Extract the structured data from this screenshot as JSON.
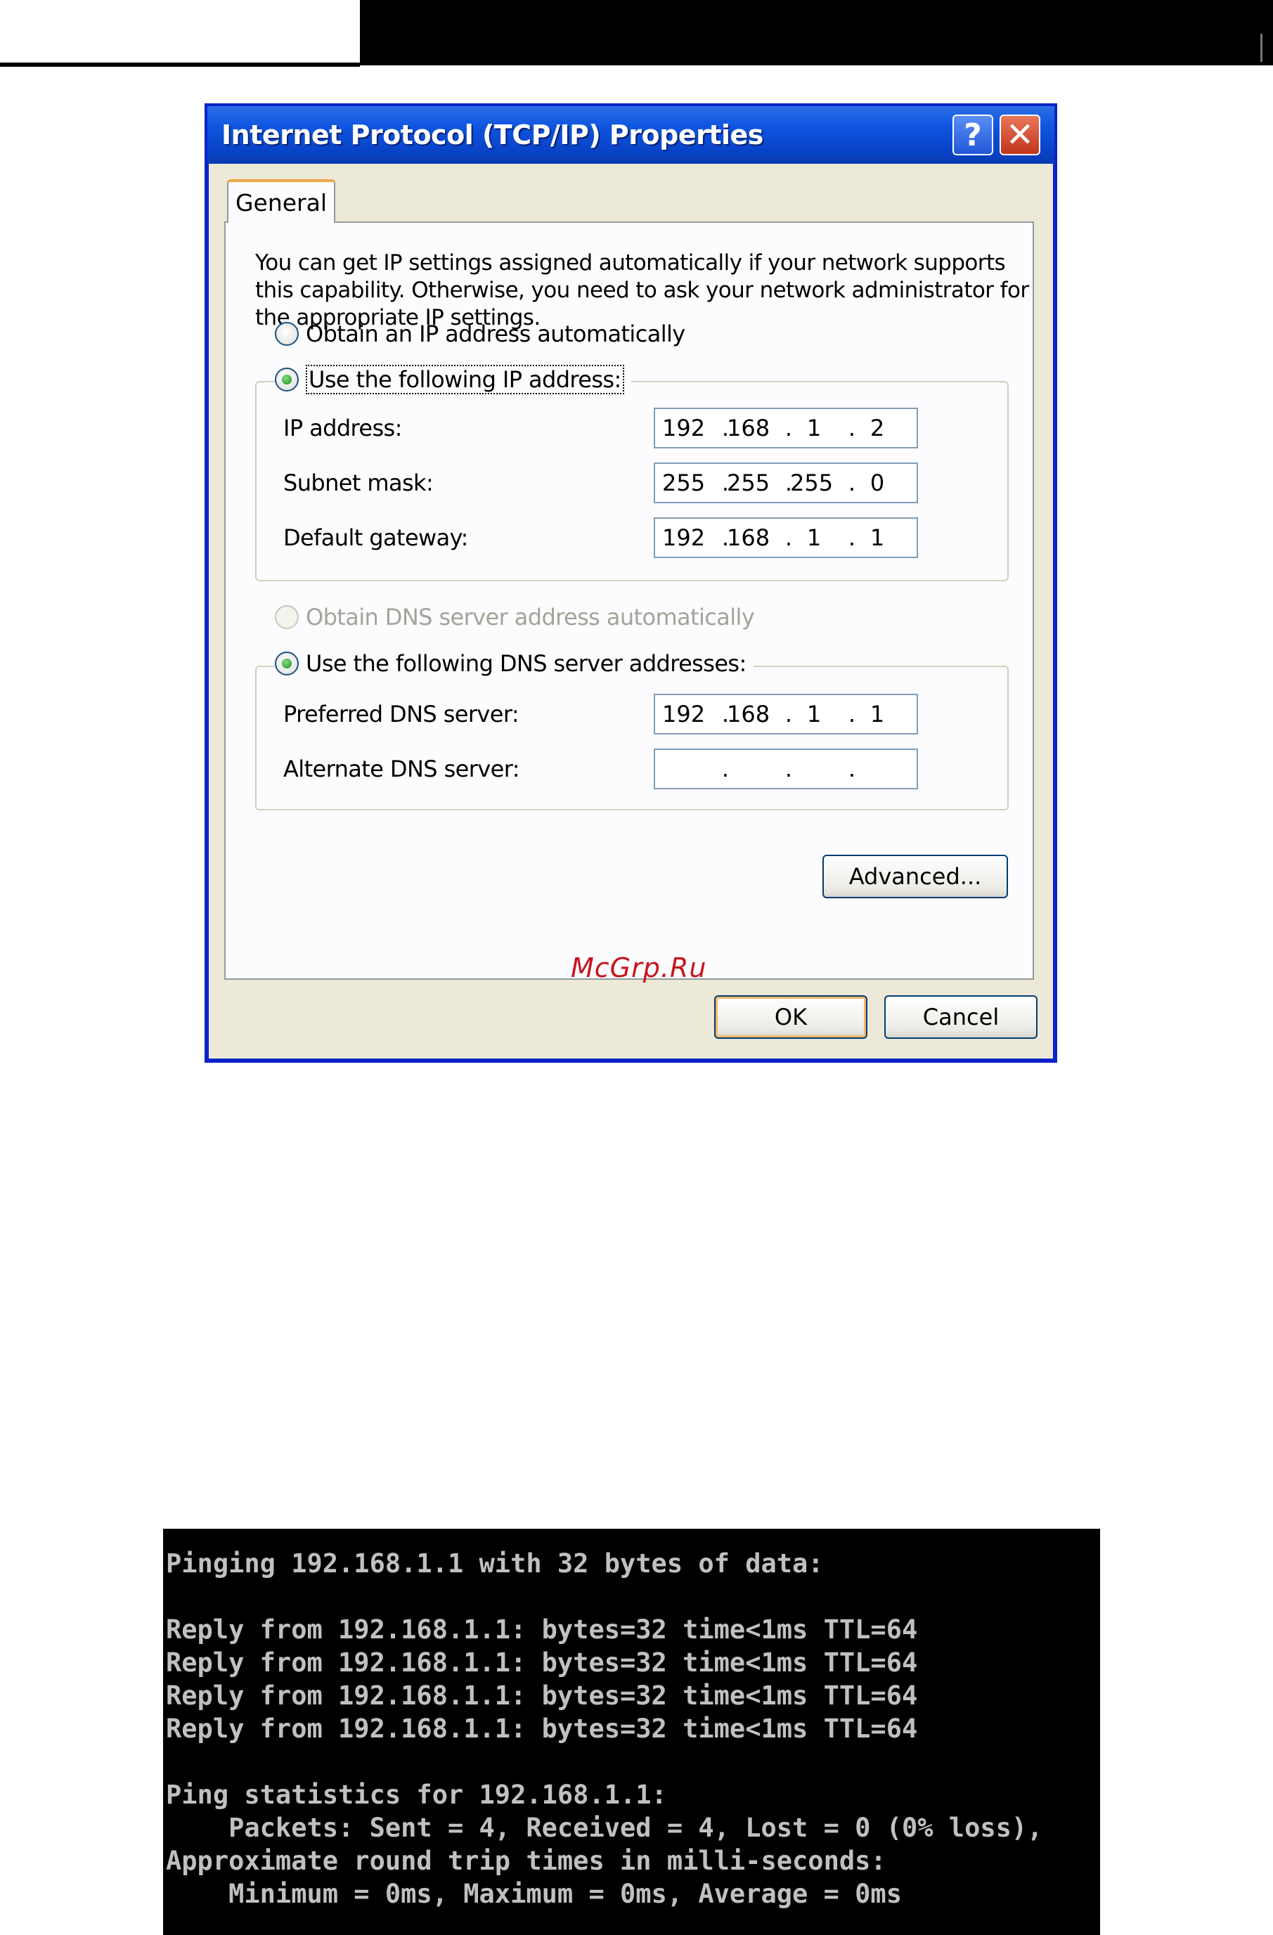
{
  "dialog": {
    "title": "Internet Protocol (TCP/IP) Properties",
    "help_glyph": "?",
    "close_glyph": "✕",
    "tab": "General",
    "intro_lines": [
      "You can get IP settings assigned automatically if your network supports",
      "this capability. Otherwise, you need to ask your network administrator for",
      "the appropriate IP settings."
    ],
    "radio_auto_ip": "Obtain an IP address automatically",
    "radio_manual_ip": "Use the following IP address:",
    "ip_label": "IP address:",
    "ip_value": [
      "192",
      "168",
      "1",
      "2"
    ],
    "subnet_label": "Subnet mask:",
    "subnet_value": [
      "255",
      "255",
      "255",
      "0"
    ],
    "gateway_label": "Default gateway:",
    "gateway_value": [
      "192",
      "168",
      "1",
      "1"
    ],
    "radio_auto_dns": "Obtain DNS server address automatically",
    "radio_manual_dns": "Use the following DNS server addresses:",
    "preferred_dns_label": "Preferred DNS server:",
    "preferred_dns_value": [
      "192",
      "168",
      "1",
      "1"
    ],
    "alternate_dns_label": "Alternate DNS server:",
    "alternate_dns_value": [
      "",
      "",
      "",
      ""
    ],
    "advanced_button": "Advanced...",
    "ok_button": "OK",
    "cancel_button": "Cancel",
    "octet_separator": "."
  },
  "watermark": "McGrp.Ru",
  "console": {
    "lines": [
      "Pinging 192.168.1.1 with 32 bytes of data:",
      "",
      "Reply from 192.168.1.1: bytes=32 time<1ms TTL=64",
      "Reply from 192.168.1.1: bytes=32 time<1ms TTL=64",
      "Reply from 192.168.1.1: bytes=32 time<1ms TTL=64",
      "Reply from 192.168.1.1: bytes=32 time<1ms TTL=64",
      "",
      "Ping statistics for 192.168.1.1:",
      "    Packets: Sent = 4, Received = 4, Lost = 0 (0% loss),",
      "Approximate round trip times in milli-seconds:",
      "    Minimum = 0ms, Maximum = 0ms, Average = 0ms"
    ]
  },
  "colors": {
    "title_bar": "#0e55e0",
    "dialog_face": "#ece9d8",
    "console_bg": "#000000",
    "console_fg": "#c0c0c0",
    "watermark": "#c8141e"
  }
}
